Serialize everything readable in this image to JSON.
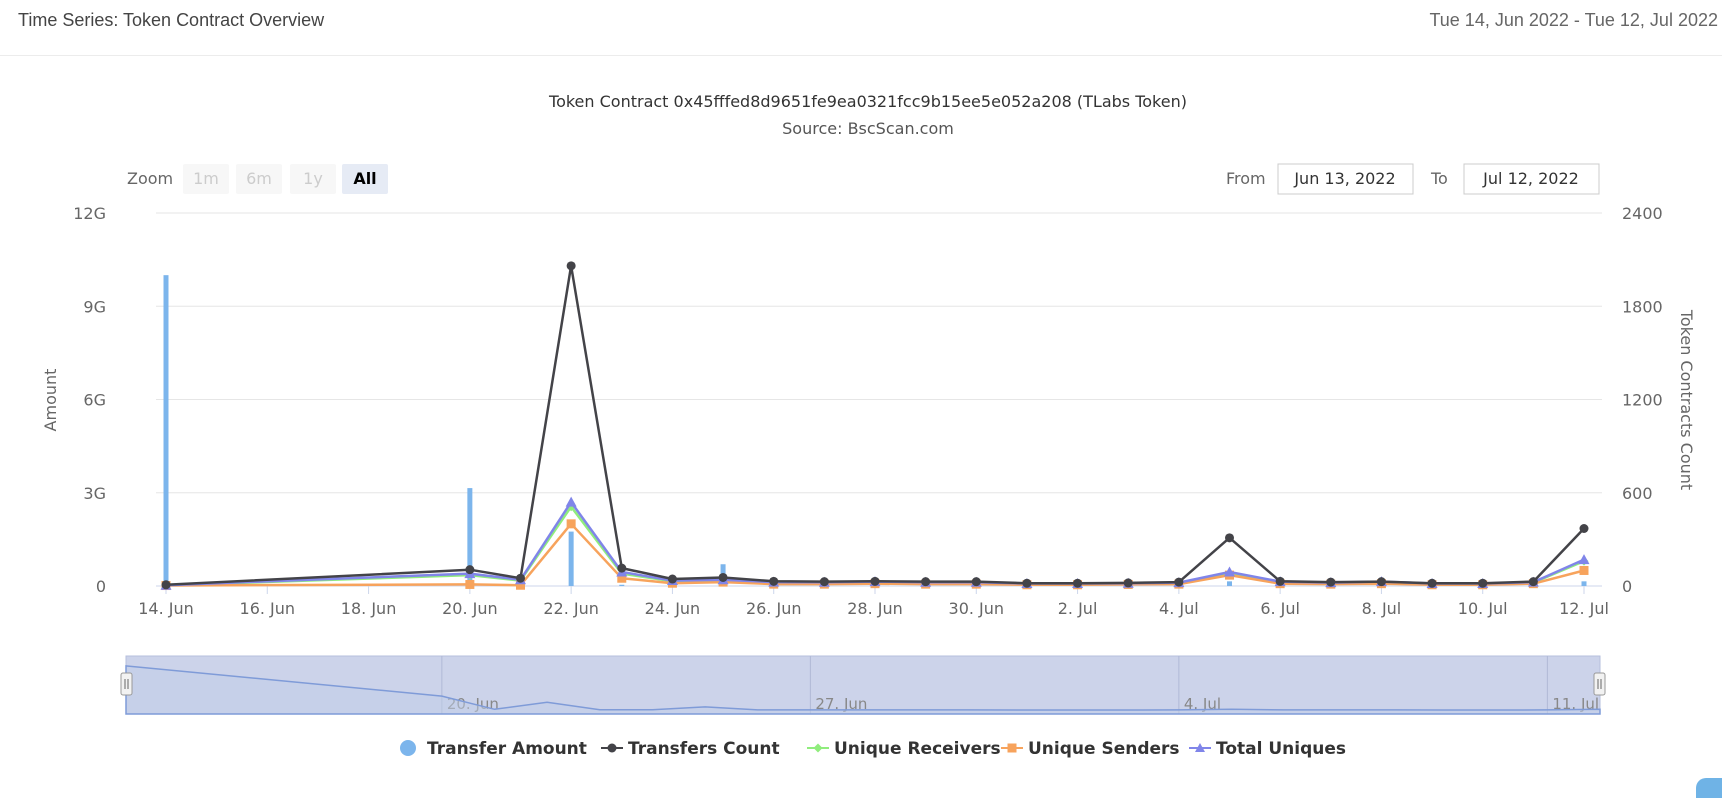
{
  "header": {
    "title": "Time Series: Token Contract Overview",
    "date_range": "Tue 14, Jun 2022 - Tue 12, Jul 2022"
  },
  "chart": {
    "title": "Token Contract 0x45fffed8d9651fe9ea0321fcc9b15ee5e052a208 (TLabs Token)",
    "subtitle": "Source: BscScan.com"
  },
  "range_selector": {
    "zoom_label": "Zoom",
    "buttons": [
      "1m",
      "6m",
      "1y",
      "All"
    ],
    "active_button": "All",
    "from_label": "From",
    "from_value": "Jun 13, 2022",
    "to_label": "To",
    "to_value": "Jul 12, 2022"
  },
  "navigator": {
    "labels": [
      "20. Jun",
      "27. Jun",
      "4. Jul",
      "11. Jul"
    ]
  },
  "colors": {
    "transfer_amount": "#7cb5ec",
    "transfers_count": "#434348",
    "unique_receivers": "#90ed7d",
    "unique_senders": "#f7a35c",
    "total_uniques": "#8085e9"
  },
  "chart_data": {
    "type": "line",
    "x": [
      "2022-06-14",
      "2022-06-20",
      "2022-06-21",
      "2022-06-22",
      "2022-06-23",
      "2022-06-24",
      "2022-06-25",
      "2022-06-26",
      "2022-06-27",
      "2022-06-28",
      "2022-06-29",
      "2022-06-30",
      "2022-07-01",
      "2022-07-02",
      "2022-07-03",
      "2022-07-04",
      "2022-07-05",
      "2022-07-06",
      "2022-07-07",
      "2022-07-08",
      "2022-07-09",
      "2022-07-10",
      "2022-07-11",
      "2022-07-12"
    ],
    "x_ticks": [
      "14. Jun",
      "16. Jun",
      "18. Jun",
      "20. Jun",
      "22. Jun",
      "24. Jun",
      "26. Jun",
      "28. Jun",
      "30. Jun",
      "2. Jul",
      "4. Jul",
      "6. Jul",
      "8. Jul",
      "10. Jul",
      "12. Jul"
    ],
    "x_tick_dates": [
      "2022-06-14",
      "2022-06-16",
      "2022-06-18",
      "2022-06-20",
      "2022-06-22",
      "2022-06-24",
      "2022-06-26",
      "2022-06-28",
      "2022-06-30",
      "2022-07-02",
      "2022-07-04",
      "2022-07-06",
      "2022-07-08",
      "2022-07-10",
      "2022-07-12"
    ],
    "xlim": [
      "2022-06-14",
      "2022-07-12"
    ],
    "y_left": {
      "label": "Amount",
      "ticks": [
        "0",
        "3G",
        "6G",
        "9G",
        "12G"
      ],
      "range": [
        0,
        12000000000
      ]
    },
    "y_right": {
      "label": "Token Contracts Count",
      "ticks": [
        "0",
        "600",
        "1200",
        "1800",
        "2400"
      ],
      "range": [
        0,
        2400
      ]
    },
    "series": [
      {
        "name": "Transfer Amount",
        "type": "column",
        "axis": "left",
        "values": [
          10000000000,
          3150000000,
          150000000,
          1750000000,
          40000000,
          50000000,
          700000000,
          20000000,
          20000000,
          30000000,
          20000000,
          20000000,
          10000000,
          10000000,
          10000000,
          20000000,
          150000000,
          20000000,
          20000000,
          20000000,
          10000000,
          10000000,
          20000000,
          150000000
        ]
      },
      {
        "name": "Transfers Count",
        "type": "line",
        "axis": "right",
        "values": [
          8,
          105,
          50,
          2060,
          115,
          45,
          55,
          30,
          28,
          30,
          28,
          28,
          18,
          18,
          20,
          25,
          310,
          30,
          25,
          28,
          18,
          18,
          28,
          370
        ]
      },
      {
        "name": "Unique Receivers",
        "type": "line",
        "axis": "right",
        "values": [
          4,
          70,
          35,
          510,
          80,
          30,
          38,
          22,
          20,
          24,
          20,
          20,
          14,
          14,
          16,
          20,
          80,
          25,
          20,
          24,
          14,
          14,
          22,
          160
        ]
      },
      {
        "name": "Unique Senders",
        "type": "line",
        "axis": "right",
        "values": [
          3,
          10,
          5,
          400,
          50,
          18,
          25,
          12,
          12,
          15,
          12,
          12,
          8,
          8,
          10,
          12,
          70,
          15,
          12,
          15,
          8,
          8,
          15,
          100
        ]
      },
      {
        "name": "Total Uniques",
        "type": "line",
        "axis": "right",
        "values": [
          5,
          80,
          40,
          540,
          90,
          35,
          40,
          25,
          24,
          28,
          24,
          24,
          16,
          16,
          18,
          22,
          90,
          28,
          22,
          28,
          16,
          16,
          25,
          170
        ]
      }
    ],
    "legend": {
      "position": "bottom-center"
    },
    "grid": true
  }
}
